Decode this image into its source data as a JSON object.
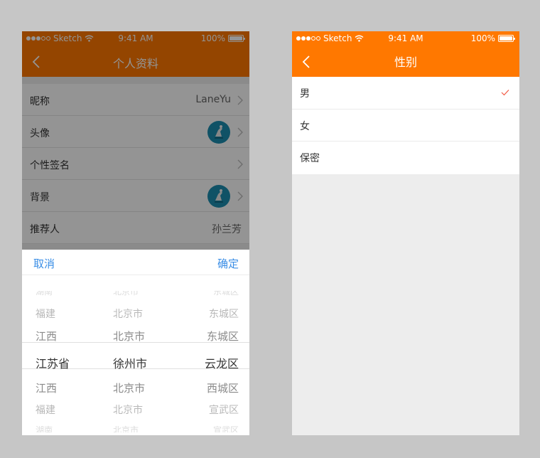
{
  "status_bar": {
    "carrier": "Sketch",
    "time": "9:41 AM",
    "battery": "100%"
  },
  "left_screen": {
    "title": "个人资料",
    "rows": [
      {
        "label": "昵称",
        "value": "LaneYu"
      },
      {
        "label": "头像",
        "value": ""
      },
      {
        "label": "个性签名",
        "value": ""
      },
      {
        "label": "背景",
        "value": ""
      },
      {
        "label": "推荐人",
        "value": "孙兰芳"
      }
    ],
    "picker": {
      "cancel_label": "取消",
      "confirm_label": "确定",
      "rows": [
        {
          "province": "湖南",
          "city": "北京市",
          "district": "东城区"
        },
        {
          "province": "福建",
          "city": "北京市",
          "district": "东城区"
        },
        {
          "province": "江西",
          "city": "北京市",
          "district": "东城区"
        },
        {
          "province": "江苏省",
          "city": "徐州市",
          "district": "云龙区"
        },
        {
          "province": "江西",
          "city": "北京市",
          "district": "西城区"
        },
        {
          "province": "福建",
          "city": "北京市",
          "district": "宣武区"
        },
        {
          "province": "湖南",
          "city": "北京市",
          "district": "宣武区"
        }
      ]
    }
  },
  "right_screen": {
    "title": "性别",
    "options": [
      {
        "label": "男",
        "selected": true
      },
      {
        "label": "女",
        "selected": false
      },
      {
        "label": "保密",
        "selected": false
      }
    ]
  },
  "colors": {
    "accent": "#ff7800",
    "link": "#3a8ee6",
    "check": "#ff7800",
    "page_bg": "#c6c6c6"
  }
}
